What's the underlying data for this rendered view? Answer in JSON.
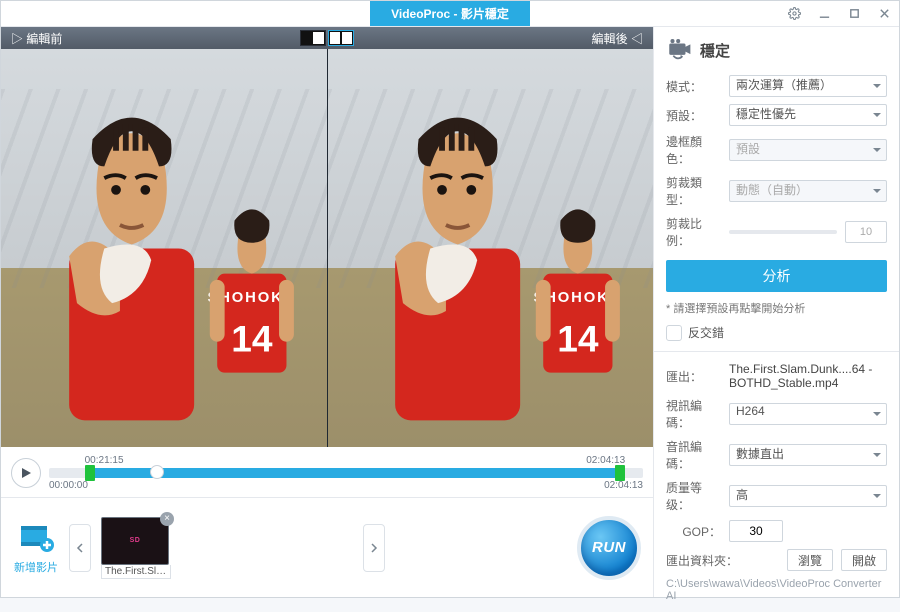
{
  "app": {
    "title_full": "VideoProc - 影片穩定"
  },
  "preview": {
    "before_label": "▷ 編輯前",
    "after_label": "編輯後 ◁"
  },
  "timeline": {
    "in_time": "00:21:15",
    "out_time": "02:04:13",
    "start_time": "00:00:00",
    "end_time": "02:04:13"
  },
  "stab": {
    "heading": "穩定",
    "mode_label": "模式：",
    "mode_value": "兩次運算（推薦）",
    "preset_label": "預設：",
    "preset_value": "穩定性優先",
    "border_label": "邊框顏色：",
    "border_value": "預設",
    "croptype_label": "剪裁類型：",
    "croptype_value": "動態（自動）",
    "cropratio_label": "剪裁比例：",
    "cropratio_value": "10",
    "analyze_btn": "分析",
    "hint": "* 請選擇預設再點擊開始分析",
    "deinterlace_label": "反交錯"
  },
  "output": {
    "file_label": "匯出：",
    "file_value": "The.First.Slam.Dunk....64 -BOTHD_Stable.mp4",
    "vcodec_label": "視訊編碼：",
    "vcodec_value": "H264",
    "acodec_label": "音訊編碼：",
    "acodec_value": "數據直出",
    "quality_label": "质量等级：",
    "quality_value": "高",
    "gop_label": "GOP：",
    "gop_value": "30",
    "folder_label": "匯出資料夾：",
    "browse_btn": "瀏覽",
    "open_btn": "開啟",
    "folder_path": "C:\\Users\\wawa\\Videos\\VideoProc Converter AI"
  },
  "bottom": {
    "add_label": "新增影片",
    "thumb_name": "The.First.Slam.D",
    "run_label": "RUN"
  }
}
